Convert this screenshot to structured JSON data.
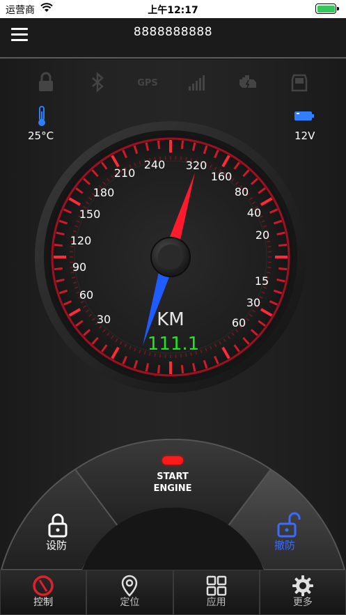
{
  "status_bar": {
    "carrier": "运营商",
    "time": "上午12:17",
    "battery_color": "#34c759"
  },
  "nav": {
    "title": "8888888888",
    "menu_icon": "hamburger-icon"
  },
  "indicators": [
    "lock-icon",
    "bluetooth-icon",
    "gps-icon",
    "signal-icon",
    "engine-icon",
    "door-icon"
  ],
  "indicator_gps_text": "GPS",
  "temperature": {
    "icon": "thermometer-icon",
    "value": "25°C"
  },
  "voltage": {
    "icon": "battery-icon",
    "value": "12V"
  },
  "gauge": {
    "left_labels": [
      "210",
      "180",
      "150",
      "120",
      "90",
      "60",
      "30"
    ],
    "top_labels": [
      "240",
      "320"
    ],
    "right_labels": [
      "160",
      "80",
      "40",
      "20",
      "15",
      "30",
      "60"
    ],
    "unit": "KM",
    "reading": "111.1",
    "needle_red": "#ff1a2e",
    "needle_blue": "#1e5cff",
    "reading_color": "#22e622"
  },
  "controls": {
    "arm_label": "设防",
    "start_label_line1": "START",
    "start_label_line2": "ENGINE",
    "disarm_label": "撤防",
    "disarm_color": "#3b6cff"
  },
  "tabs": [
    {
      "label": "控制",
      "icon": "compass-icon"
    },
    {
      "label": "定位",
      "icon": "location-pin-icon"
    },
    {
      "label": "应用",
      "icon": "grid-icon"
    },
    {
      "label": "更多",
      "icon": "gear-icon"
    }
  ]
}
